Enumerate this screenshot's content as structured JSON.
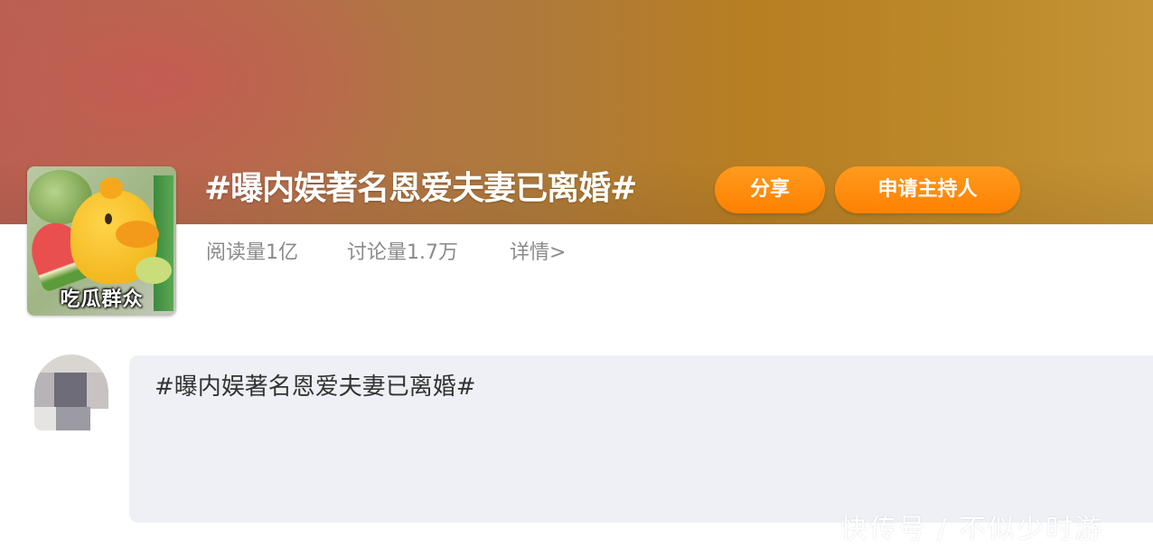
{
  "topic": {
    "title": "#曝内娱著名恩爱夫妻已离婚#",
    "cover_caption": "吃瓜群众",
    "share_label": "分享",
    "apply_host_label": "申请主持人",
    "read_count": "阅读量1亿",
    "discussion_count": "讨论量1.7万",
    "detail_link": "详情>"
  },
  "composer": {
    "text": "#曝内娱著名恩爱夫妻已离婚#"
  },
  "watermark": "快传号 / 不似少时游",
  "colors": {
    "accent_orange": "#ff8a0f",
    "stat_gray": "#8a8a8a",
    "composer_bg": "#eef0f5"
  }
}
